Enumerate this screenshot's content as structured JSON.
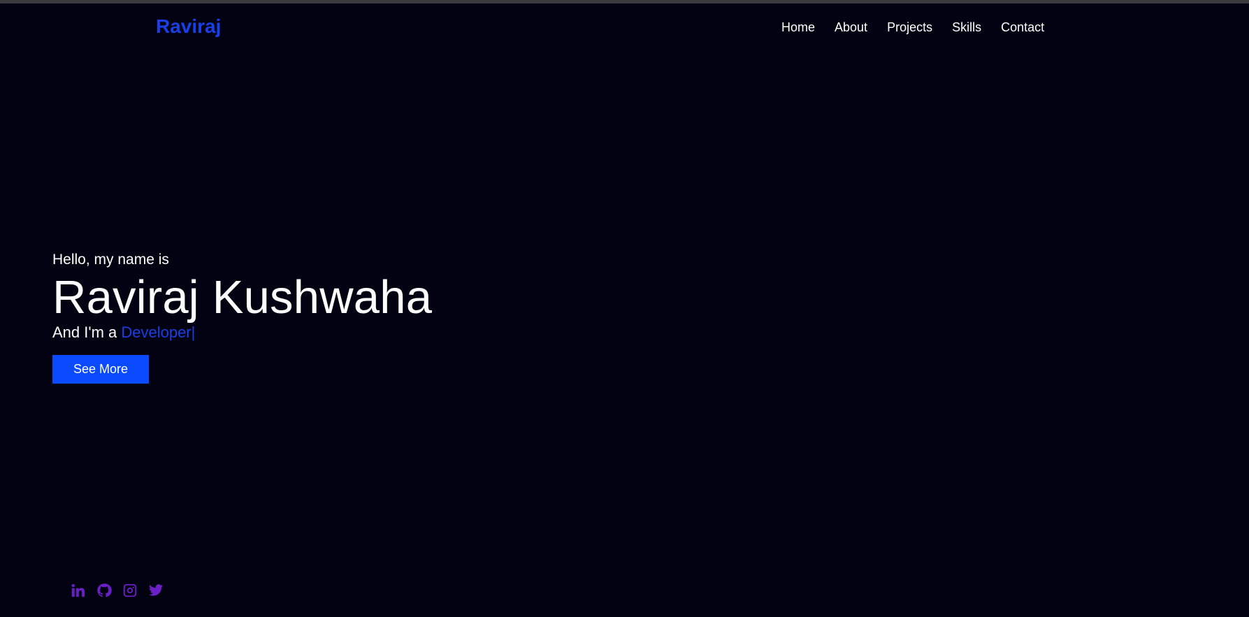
{
  "brand": {
    "logo_text": "Raviraj"
  },
  "nav": {
    "items": [
      {
        "label": "Home"
      },
      {
        "label": "About"
      },
      {
        "label": "Projects"
      },
      {
        "label": "Skills"
      },
      {
        "label": "Contact"
      }
    ]
  },
  "hero": {
    "greeting": "Hello, my name is",
    "name": "Raviraj Kushwaha",
    "role_prefix": "And I'm a ",
    "role_word": "Developer",
    "cursor": "|",
    "cta_label": "See More"
  },
  "socials": {
    "icons": [
      "linkedin-icon",
      "github-icon",
      "instagram-icon",
      "twitter-icon"
    ]
  },
  "colors": {
    "background": "#020212",
    "accent": "#1a3fe6",
    "button": "#0a4bff",
    "social_icon": "#6d1fc7"
  }
}
